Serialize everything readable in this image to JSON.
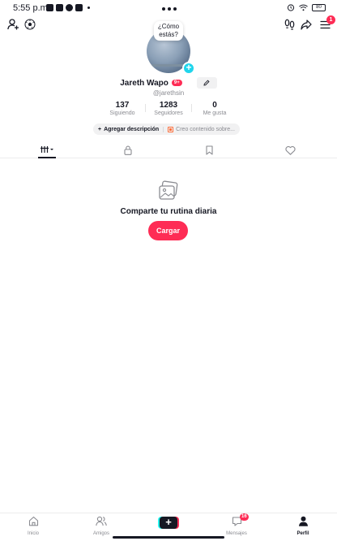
{
  "status_bar": {
    "time": "5:55 p.m.",
    "battery": "80"
  },
  "header": {
    "notification_count": "1"
  },
  "profile": {
    "bubble_text": "¿Cómo estás?",
    "name": "Jareth Wapo",
    "name_badge": "9+",
    "handle": "@jarethsin"
  },
  "stats": [
    {
      "value": "137",
      "label": "Siguiendo"
    },
    {
      "value": "1283",
      "label": "Seguidores"
    },
    {
      "value": "0",
      "label": "Me gusta"
    }
  ],
  "pills": {
    "add_description": "Agregar descripción",
    "creator": "Creo contenido sobre..."
  },
  "empty_state": {
    "title": "Comparte tu rutina diaria",
    "button": "Cargar"
  },
  "nav": {
    "home": "Inicio",
    "friends": "Amigos",
    "messages": "Mensajes",
    "messages_badge": "16",
    "profile": "Perfil"
  },
  "colors": {
    "accent": "#fe2c55",
    "add_badge": "#20d5ec",
    "text": "#161823",
    "muted": "#8a8b91"
  }
}
